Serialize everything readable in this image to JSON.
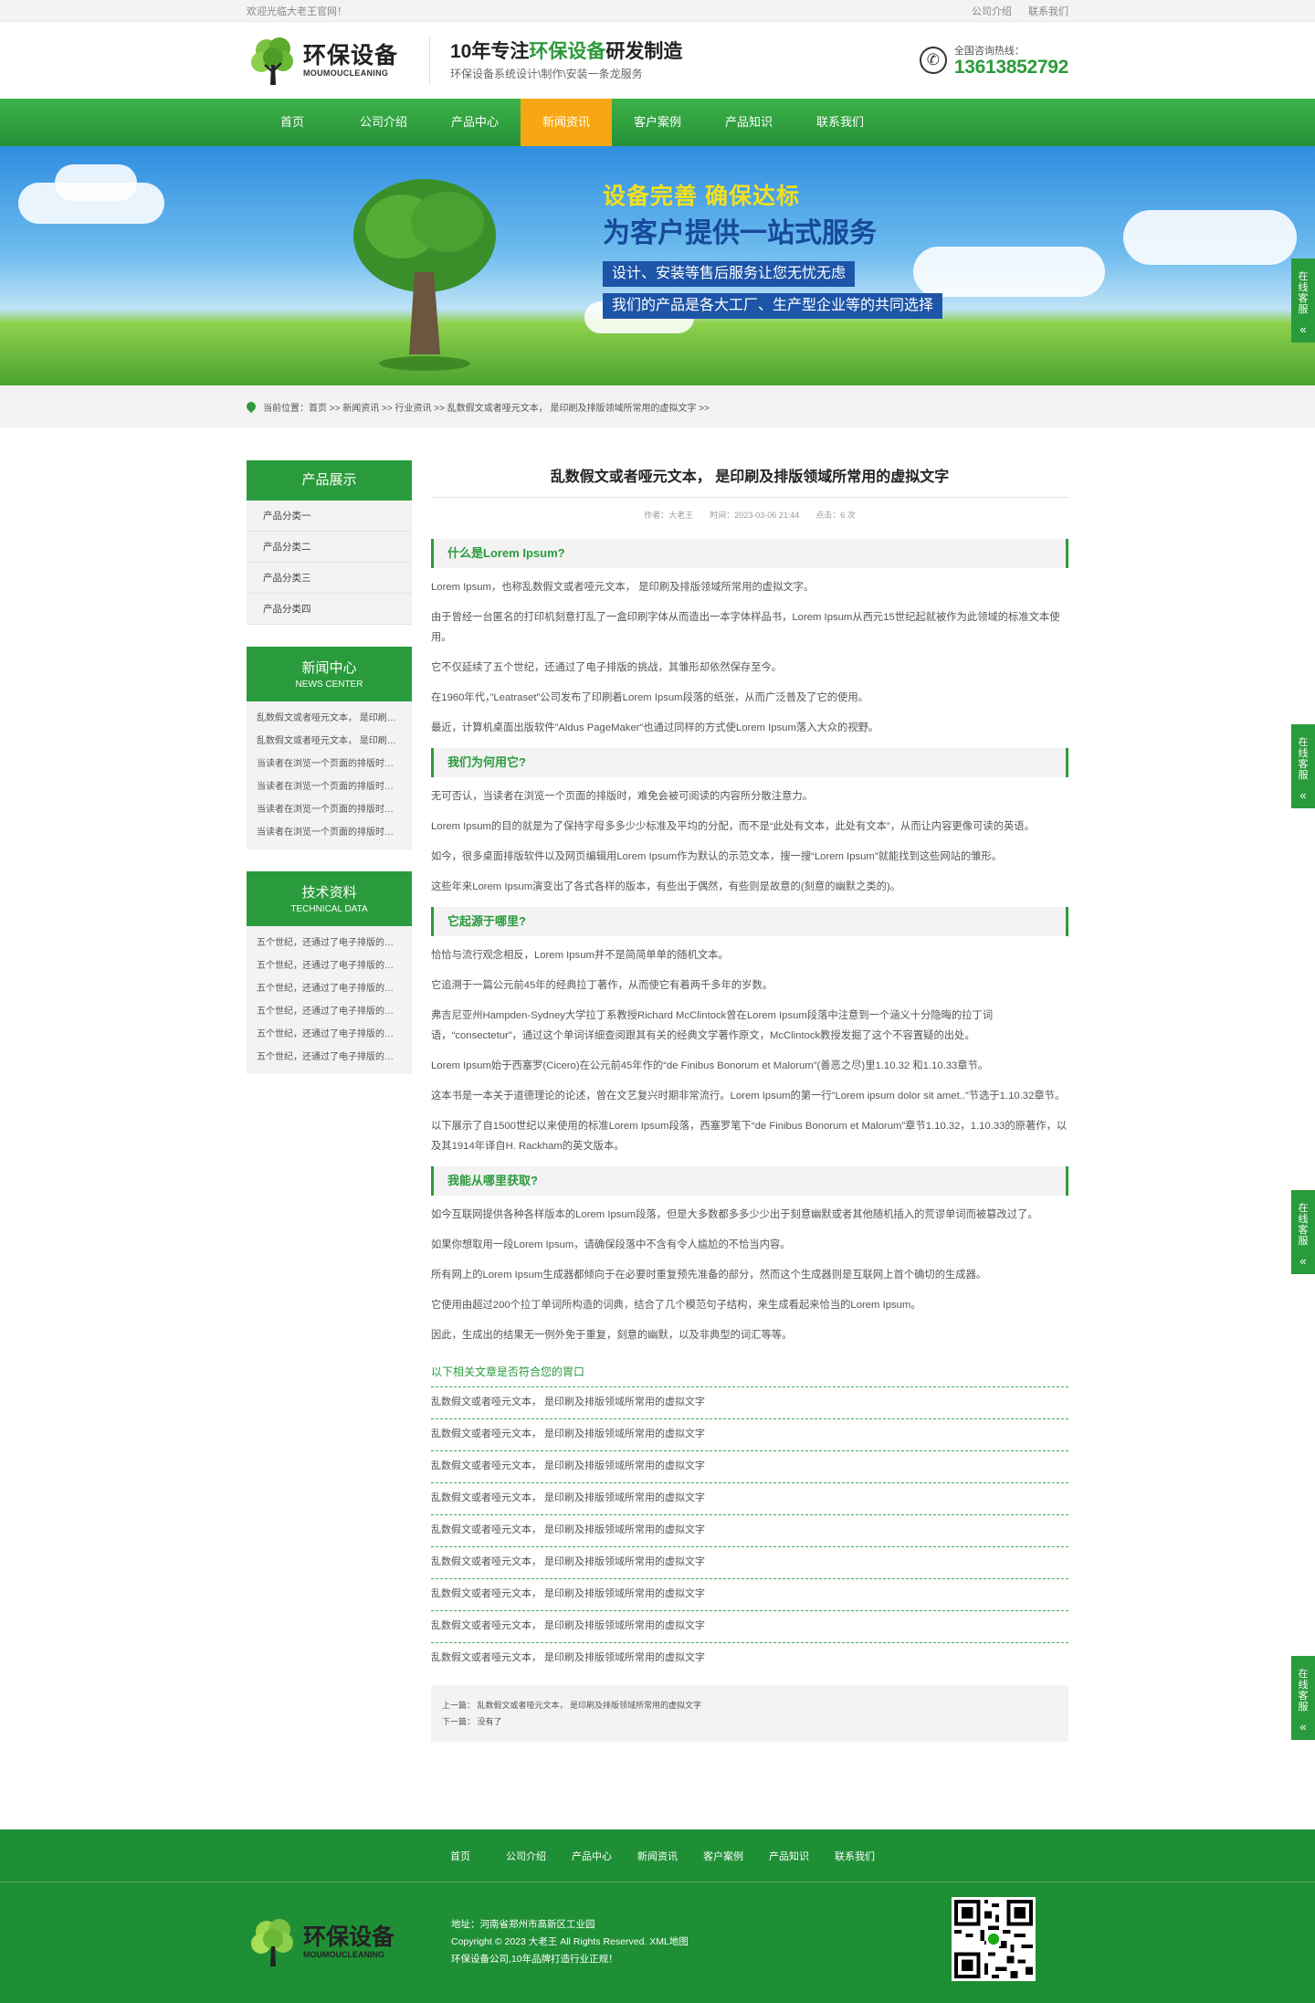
{
  "topbar": {
    "welcome": "欢迎光临大老王官网！",
    "links": [
      "公司介绍",
      "联系我们"
    ]
  },
  "header": {
    "logo_cn": "环保设备",
    "logo_en": "MOUMOUCLEANING",
    "slogan_prefix": "10年专注",
    "slogan_highlight": "环保设备",
    "slogan_suffix": "研发制造",
    "slogan_sub": "环保设备系统设计\\制作\\安装一条龙服务",
    "hotline_label": "全国咨询热线：",
    "hotline": "13613852792"
  },
  "nav": [
    "首页",
    "公司介绍",
    "产品中心",
    "新闻资讯",
    "客户案例",
    "产品知识",
    "联系我们"
  ],
  "banner": {
    "line1": "设备完善 确保达标",
    "line2": "为客户提供一站式服务",
    "line3": "设计、安装等售后服务让您无忧无虑",
    "line4": "我们的产品是各大工厂、生产型企业等的共同选择"
  },
  "breadcrumb": "当前位置：首页 >> 新闻资讯 >> 行业资讯 >> 乱数假文或者哑元文本， 是印刷及排版领域所常用的虚拟文字 >>",
  "sidebar": {
    "products_title": "产品展示",
    "products": [
      "产品分类一",
      "产品分类二",
      "产品分类三",
      "产品分类四"
    ],
    "news_title": "新闻中心",
    "news_title_en": "NEWS CENTER",
    "news": [
      "乱数假文或者哑元文本， 是印刷及排版领域所常用的虚拟文字",
      "乱数假文或者哑元文本， 是印刷及排版领域所常用的虚拟文字",
      "当读者在浏览一个页面的排版时，难免会被可阅读的内容所分散注意力",
      "当读者在浏览一个页面的排版时，难免会被可阅读的内容所分散注意力",
      "当读者在浏览一个页面的排版时，难免会被可阅读的内容所分散注意力",
      "当读者在浏览一个页面的排版时，难免会被可阅读的内容所分散注意力"
    ],
    "tech_title": "技术资料",
    "tech_title_en": "TECHNICAL DATA",
    "tech": [
      "五个世纪，还通过了电子排版的挑战，其雏形却依然保存至今",
      "五个世纪，还通过了电子排版的挑战，其雏形却依然保存至今",
      "五个世纪，还通过了电子排版的挑战，其雏形却依然保存至今",
      "五个世纪，还通过了电子排版的挑战，其雏形却依然保存至今",
      "五个世纪，还通过了电子排版的挑战，其雏形却依然保存至今",
      "五个世纪，还通过了电子排版的挑战，其雏形却依然保存至今"
    ]
  },
  "article": {
    "title": "乱数假文或者哑元文本， 是印刷及排版领域所常用的虚拟文字",
    "author": "作者：大老王",
    "time": "时间：2023-03-06 21:44",
    "hits": "点击：6 次",
    "s1": "什么是Lorem Ipsum?",
    "p1": [
      "Lorem Ipsum，也称乱数假文或者哑元文本， 是印刷及排版领域所常用的虚拟文字。",
      "由于曾经一台匿名的打印机刻意打乱了一盒印刷字体从而造出一本字体样品书，Lorem Ipsum从西元15世纪起就被作为此领域的标准文本使用。",
      "它不仅延续了五个世纪，还通过了电子排版的挑战，其雏形却依然保存至今。",
      "在1960年代，”Leatraset”公司发布了印刷着Lorem Ipsum段落的纸张，从而广泛普及了它的使用。",
      "最近，计算机桌面出版软件”Aldus PageMaker”也通过同样的方式使Lorem Ipsum落入大众的视野。"
    ],
    "s2": "我们为何用它?",
    "p2": [
      "无可否认，当读者在浏览一个页面的排版时，难免会被可阅读的内容所分散注意力。",
      "Lorem Ipsum的目的就是为了保持字母多多少少标准及平均的分配，而不是“此处有文本，此处有文本”，从而让内容更像可读的英语。",
      "如今，很多桌面排版软件以及网页编辑用Lorem Ipsum作为默认的示范文本，搜一搜“Lorem Ipsum”就能找到这些网站的雏形。",
      "这些年来Lorem Ipsum演变出了各式各样的版本，有些出于偶然，有些则是故意的(刻意的幽默之类的)。"
    ],
    "s3": "它起源于哪里?",
    "p3": [
      "恰恰与流行观念相反，Lorem Ipsum并不是简简单单的随机文本。",
      "它追溯于一篇公元前45年的经典拉丁著作，从而使它有着两千多年的岁数。",
      "弗吉尼亚州Hampden-Sydney大学拉丁系教授Richard McClintock曾在Lorem Ipsum段落中注意到一个涵义十分隐晦的拉丁词语，“consectetur”，通过这个单词详细查阅跟其有关的经典文学著作原文，McClintock教授发掘了这个不容置疑的出处。",
      "Lorem Ipsum始于西塞罗(Cicero)在公元前45年作的“de Finibus Bonorum et Malorum”(善恶之尽)里1.10.32 和1.10.33章节。",
      "这本书是一本关于道德理论的论述，曾在文艺复兴时期非常流行。Lorem Ipsum的第一行”Lorem ipsum dolor sit amet..”节选于1.10.32章节。",
      "以下展示了自1500世纪以来使用的标准Lorem Ipsum段落，西塞罗笔下“de Finibus Bonorum et Malorum”章节1.10.32，1.10.33的原著作，以及其1914年译自H. Rackham的英文版本。"
    ],
    "s4": "我能从哪里获取?",
    "p4": [
      "如今互联网提供各种各样版本的Lorem Ipsum段落，但是大多数都多多少少出于刻意幽默或者其他随机插入的荒谬单词而被篡改过了。",
      "如果你想取用一段Lorem Ipsum，请确保段落中不含有令人尴尬的不恰当内容。",
      "所有网上的Lorem Ipsum生成器都倾向于在必要时重复预先准备的部分，然而这个生成器则是互联网上首个确切的生成器。",
      "它使用由超过200个拉丁单词所构造的词典，结合了几个模范句子结构，来生成看起来恰当的Lorem Ipsum。",
      "因此，生成出的结果无一例外免于重复，刻意的幽默，以及非典型的词汇等等。"
    ],
    "related_title": "以下相关文章是否符合您的胃口",
    "related": [
      "乱数假文或者哑元文本， 是印刷及排版领域所常用的虚拟文字",
      "乱数假文或者哑元文本， 是印刷及排版领域所常用的虚拟文字",
      "乱数假文或者哑元文本， 是印刷及排版领域所常用的虚拟文字",
      "乱数假文或者哑元文本， 是印刷及排版领域所常用的虚拟文字",
      "乱数假文或者哑元文本， 是印刷及排版领域所常用的虚拟文字",
      "乱数假文或者哑元文本， 是印刷及排版领域所常用的虚拟文字",
      "乱数假文或者哑元文本， 是印刷及排版领域所常用的虚拟文字",
      "乱数假文或者哑元文本， 是印刷及排版领域所常用的虚拟文字",
      "乱数假文或者哑元文本， 是印刷及排版领域所常用的虚拟文字"
    ],
    "prev": "上一篇： 乱数假文或者哑元文本， 是印刷及排版领域所常用的虚拟文字",
    "next": "下一篇： 没有了"
  },
  "float_service": {
    "label": "在线客服",
    "arrow": "«"
  },
  "footer": {
    "nav": [
      "首页",
      "公司介绍",
      "产品中心",
      "新闻资讯",
      "客户案例",
      "产品知识",
      "联系我们"
    ],
    "logo_cn": "环保设备",
    "logo_en": "MOUMOUCLEANING",
    "address": "地址：河南省郑州市高新区工业园",
    "copyright": "Copyright © 2023 大老王 All Rights Reserved. XML地图",
    "tagline": "环保设备公司,10年品牌打造行业正规！"
  },
  "colors": {
    "green": "#2a9b3c",
    "orange": "#f6a713",
    "blue": "#1d55a8"
  }
}
